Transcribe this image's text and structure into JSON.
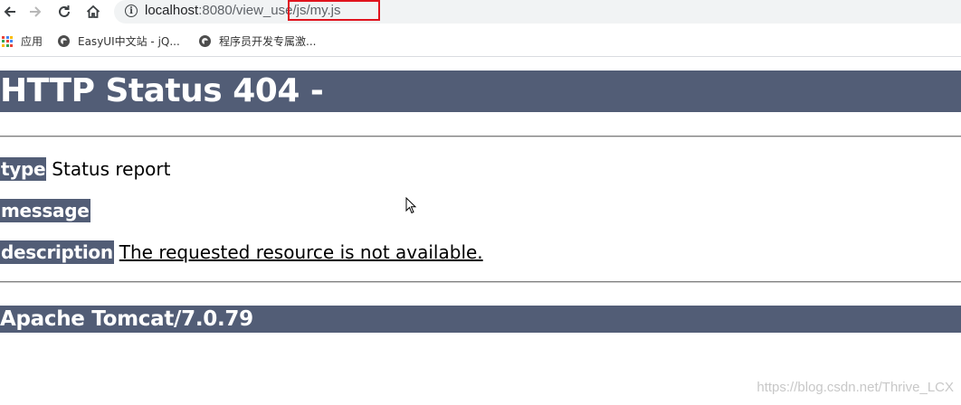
{
  "browser": {
    "url_host": "localhost",
    "url_path": ":8080/view_use/js/my.js",
    "highlight_color": "#e0141e",
    "bookmarks": [
      {
        "label": "应用",
        "icon": "apps-grid-icon"
      },
      {
        "label": "EasyUI中文站 - jQ...",
        "icon": "globe-icon"
      },
      {
        "label": "程序员开发专属激...",
        "icon": "globe-icon"
      }
    ]
  },
  "page": {
    "heading": "HTTP Status 404 -",
    "type_label": "type",
    "type_value": "Status report",
    "message_label": "message",
    "message_value": "",
    "description_label": "description",
    "description_value": "The requested resource is not available.",
    "footer": "Apache Tomcat/7.0.79",
    "bar_color": "#525d76"
  },
  "watermark": "https://blog.csdn.net/Thrive_LCX"
}
